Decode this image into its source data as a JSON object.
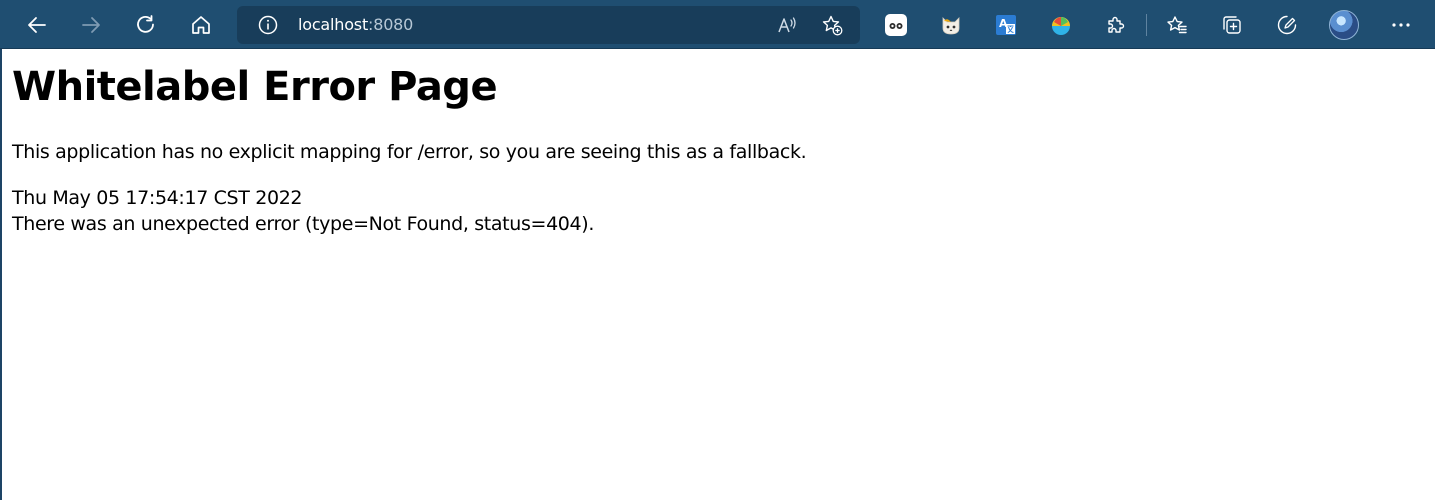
{
  "browser": {
    "address_bar": {
      "host": "localhost",
      "port": ":8080"
    },
    "icons": {
      "back": "back-arrow-icon",
      "forward": "forward-arrow-icon",
      "refresh": "refresh-icon",
      "home": "home-icon",
      "site_info": "info-icon",
      "read_aloud": "read-aloud-icon",
      "add_favorite": "add-favorite-icon",
      "extensions": [
        "ghost-extension-icon",
        "cat-extension-icon",
        "translate-extension-icon",
        "ball-extension-icon",
        "extensions-puzzle-icon"
      ],
      "favorites": "favorites-icon",
      "collections": "collections-icon",
      "performance": "performance-icon",
      "profile": "profile-avatar",
      "menu": "more-menu-icon"
    },
    "colors": {
      "toolbar": "#1f4e71",
      "address_bar": "#183d5a",
      "accent_translate": "#2b7cd3"
    }
  },
  "page": {
    "heading": "Whitelabel Error Page",
    "message": "This application has no explicit mapping for /error, so you are seeing this as a fallback.",
    "timestamp": "Thu May 05 17:54:17 CST 2022",
    "error": "There was an unexpected error (type=Not Found, status=404)."
  }
}
